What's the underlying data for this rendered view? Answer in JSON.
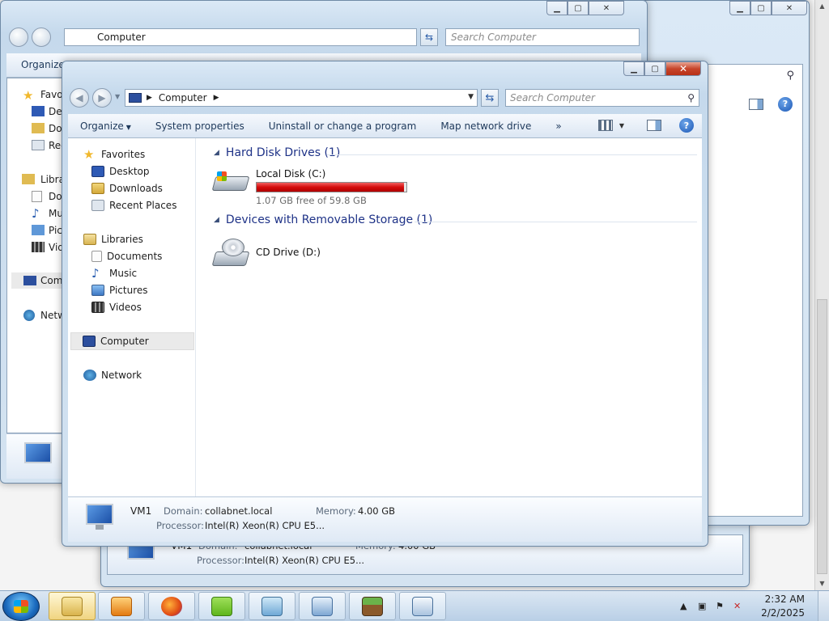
{
  "main_window": {
    "address": "Computer",
    "search_placeholder": "Search Computer",
    "toolbar": {
      "organize": "Organize",
      "system_properties": "System properties",
      "uninstall": "Uninstall or change a program",
      "map_drive": "Map network drive",
      "more": "»"
    },
    "nav": {
      "favorites": "Favorites",
      "desktop": "Desktop",
      "downloads": "Downloads",
      "recent_places": "Recent Places",
      "libraries": "Libraries",
      "documents": "Documents",
      "music": "Music",
      "pictures": "Pictures",
      "videos": "Videos",
      "computer": "Computer",
      "network": "Network"
    },
    "groups": {
      "hdd": "Hard Disk Drives (1)",
      "removable": "Devices with Removable Storage (1)"
    },
    "drives": {
      "c_name": "Local Disk (C:)",
      "c_free": "1.07 GB free of 59.8 GB",
      "c_used_fraction": 0.982,
      "d_name": "CD Drive (D:)"
    },
    "details": {
      "name": "VM1",
      "domain_label": "Domain:",
      "domain": "collabnet.local",
      "memory_label": "Memory:",
      "memory": "4.00 GB",
      "processor_label": "Processor:",
      "processor": "Intel(R) Xeon(R) CPU E5..."
    }
  },
  "background_window": {
    "address": "Computer",
    "search_placeholder": "Search Computer",
    "organize": "Organize",
    "nav_partial": [
      "Favo",
      "De",
      "Do",
      "Rec",
      "Libra",
      "Do",
      "Mu",
      "Pic",
      "Vid",
      "Com",
      "Netw"
    ],
    "details": {
      "name": "VM1",
      "domain_label": "Domain:",
      "domain": "collabnet.local",
      "memory_label": "Memory:",
      "memory": "4.00 GB",
      "processor_label": "Processor:",
      "processor": "Intel(R) Xeon(R) CPU E5..."
    }
  },
  "taskbar": {
    "time": "2:32 AM",
    "date": "2/2/2025",
    "apps": [
      "explorer",
      "media-player",
      "firefox",
      "nvidia",
      "task-app",
      "control-panel",
      "minecraft",
      "remote-app"
    ]
  },
  "colors": {
    "disk_bar_fill": "#d40d0d",
    "group_header": "#1e3287"
  }
}
